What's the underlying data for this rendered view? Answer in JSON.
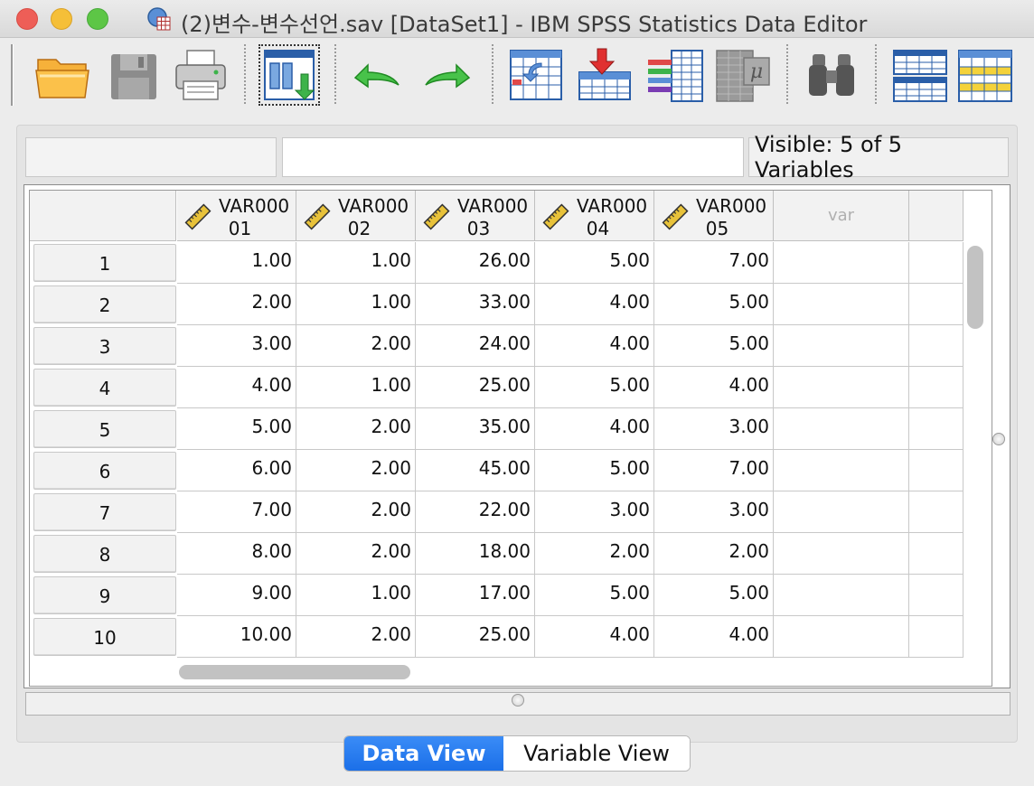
{
  "window": {
    "title": "(2)변수-변수선언.sav [DataSet1] - IBM SPSS Statistics Data Editor"
  },
  "toolbar": {
    "buttons": [
      {
        "name": "open-data-document",
        "icon": "folder-icon"
      },
      {
        "name": "save-document",
        "icon": "floppy-disk-icon"
      },
      {
        "name": "print",
        "icon": "printer-icon"
      },
      {
        "name": "recall-dialog",
        "icon": "recall-dialog-icon"
      },
      {
        "name": "undo",
        "icon": "undo-arrow-icon"
      },
      {
        "name": "redo",
        "icon": "redo-arrow-icon"
      },
      {
        "name": "go-to-case",
        "icon": "go-to-case-icon"
      },
      {
        "name": "go-to-variable",
        "icon": "go-to-variable-icon"
      },
      {
        "name": "variables",
        "icon": "variables-icon"
      },
      {
        "name": "run-descriptive-statistics",
        "icon": "mu-grid-icon"
      },
      {
        "name": "find",
        "icon": "binoculars-icon"
      },
      {
        "name": "split-file",
        "icon": "split-file-icon"
      },
      {
        "name": "select-cases",
        "icon": "select-cases-icon"
      }
    ]
  },
  "status": {
    "cell_reference": "",
    "cell_value": "",
    "visible_text": "Visible: 5 of 5 Variables"
  },
  "grid": {
    "columns": [
      {
        "line1": "VAR000",
        "line2": "01"
      },
      {
        "line1": "VAR000",
        "line2": "02"
      },
      {
        "line1": "VAR000",
        "line2": "03"
      },
      {
        "line1": "VAR000",
        "line2": "04"
      },
      {
        "line1": "VAR000",
        "line2": "05"
      }
    ],
    "empty_column_label": "var",
    "rows": [
      {
        "num": "1",
        "cells": [
          "1.00",
          "1.00",
          "26.00",
          "5.00",
          "7.00"
        ]
      },
      {
        "num": "2",
        "cells": [
          "2.00",
          "1.00",
          "33.00",
          "4.00",
          "5.00"
        ]
      },
      {
        "num": "3",
        "cells": [
          "3.00",
          "2.00",
          "24.00",
          "4.00",
          "5.00"
        ]
      },
      {
        "num": "4",
        "cells": [
          "4.00",
          "1.00",
          "25.00",
          "5.00",
          "4.00"
        ]
      },
      {
        "num": "5",
        "cells": [
          "5.00",
          "2.00",
          "35.00",
          "4.00",
          "3.00"
        ]
      },
      {
        "num": "6",
        "cells": [
          "6.00",
          "2.00",
          "45.00",
          "5.00",
          "7.00"
        ]
      },
      {
        "num": "7",
        "cells": [
          "7.00",
          "2.00",
          "22.00",
          "3.00",
          "3.00"
        ]
      },
      {
        "num": "8",
        "cells": [
          "8.00",
          "2.00",
          "18.00",
          "2.00",
          "2.00"
        ]
      },
      {
        "num": "9",
        "cells": [
          "9.00",
          "1.00",
          "17.00",
          "5.00",
          "5.00"
        ]
      },
      {
        "num": "10",
        "cells": [
          "10.00",
          "2.00",
          "25.00",
          "4.00",
          "4.00"
        ]
      }
    ]
  },
  "tabs": {
    "data_view": "Data View",
    "variable_view": "Variable View",
    "active": "data_view"
  },
  "colors": {
    "active_tab": "#1b6fe8",
    "grid_line": "#c8c8c8",
    "header_bg": "#f2f2f2"
  }
}
